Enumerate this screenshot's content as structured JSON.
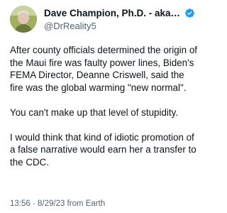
{
  "author": {
    "display_name": "Dave Champion, Ph.D. - aka D...",
    "handle": "@DrReality5",
    "verified": true,
    "verified_color": "#1d9bf0"
  },
  "tweet": {
    "paragraphs": [
      "After county officials determined the origin of the Maui fire was faulty power lines, Biden's FEMA Director, Deanne Criswell, said the fire was the global warming \"new normal\".",
      "You can't make up that level of stupidity.",
      "I would think that kind of idiotic promotion of a false narrative would earn her a transfer to the CDC."
    ],
    "timestamp": "13:56 · 8/29/23 from Earth"
  },
  "colors": {
    "text": "#0f1419",
    "secondary": "#536471",
    "background": "#ffffff"
  },
  "icons": {
    "verified": "verified-badge-icon",
    "avatar": "profile-photo"
  }
}
